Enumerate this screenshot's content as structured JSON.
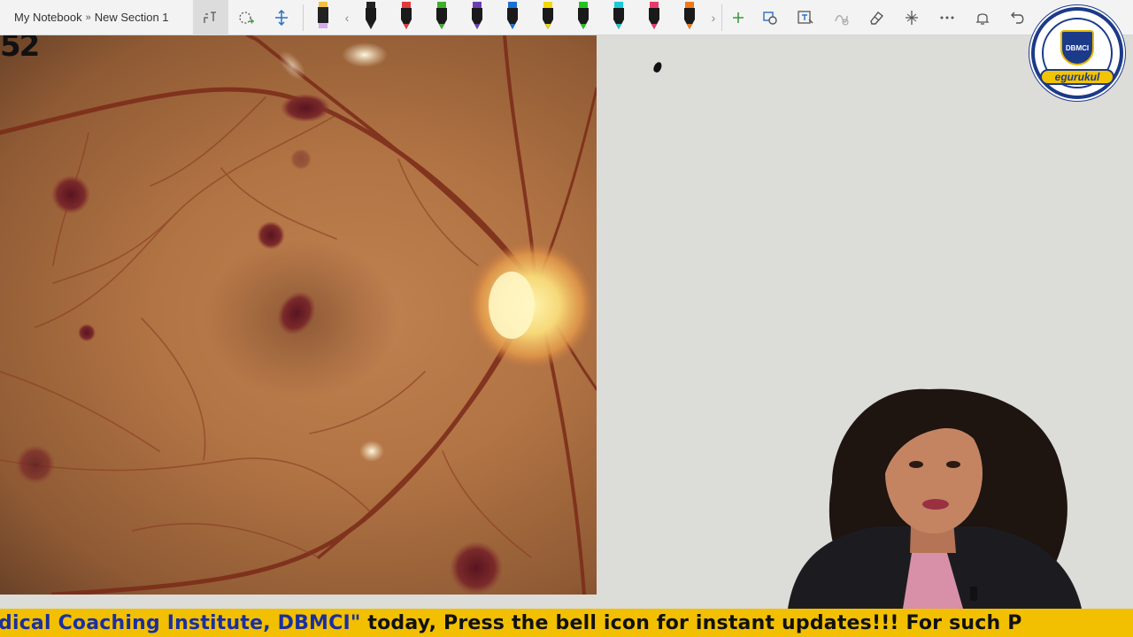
{
  "breadcrumb": {
    "notebook": "My Notebook",
    "separator": "»",
    "section": "New Section 1"
  },
  "toolbar": {
    "tools": [
      "lasso-select-icon",
      "ink-to-shape-icon",
      "add-space-icon"
    ],
    "pen_colors": [
      "#222222",
      "#e23a3a",
      "#3fae2a",
      "#6a3fb5",
      "#1f6fd1",
      "#f5d800",
      "#22c422",
      "#1ec8d6",
      "#e83a6a",
      "#f07a1a"
    ],
    "highlighter_color": "#f0d0ff",
    "right_icons": [
      "add-pen-icon",
      "shapes-icon",
      "ink-to-text-icon",
      "ink-replay-icon",
      "eraser-icon",
      "ruler-icon",
      "more-icon",
      "notifications-icon",
      "undo-icon",
      "redo-icon",
      "fullscreen-icon"
    ]
  },
  "canvas": {
    "corner_text": "52"
  },
  "logo": {
    "shield_text": "DBMCI",
    "band_text": "egurukul"
  },
  "ticker": {
    "part1": "dical Coaching Institute, DBMCI\"",
    "part2": " today, Press the bell icon for instant updates!!!   For such P"
  },
  "colors": {
    "toolbar_bg": "#f3f3f3",
    "canvas_bg": "#dcdcd8",
    "ticker_bg": "#f2c000",
    "ticker_text": "#1b2fa0"
  }
}
